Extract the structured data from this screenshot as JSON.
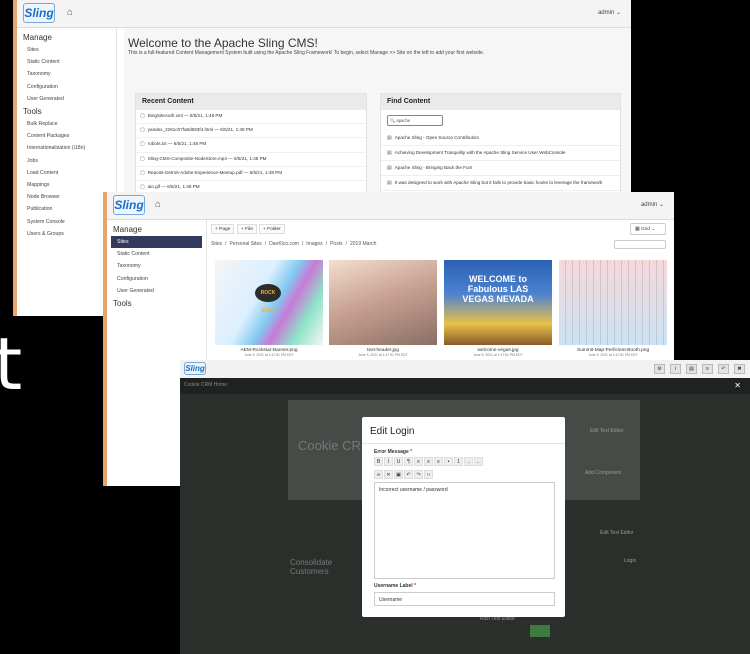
{
  "overlay_char": "t",
  "window1": {
    "user": "admin",
    "sidebar": {
      "manage_title": "Manage",
      "manage_items": [
        "Sites",
        "Static Content",
        "Taxonomy",
        "Configuration",
        "User Generated"
      ],
      "tools_title": "Tools",
      "tools_items": [
        "Bulk Replace",
        "Content Packages",
        "Internationalization (i18n)",
        "Jobs",
        "Load Content",
        "Mappings",
        "Node Browser",
        "Publication",
        "System Console",
        "Users & Groups"
      ]
    },
    "welcome_title": "Welcome to the Apache Sling CMS!",
    "welcome_text": "This is a full-featured Content Management System built using the Apache Sling Framework! To begin, select Manage >> Site on the left to add your first website.",
    "recent": {
      "title": "Recent Content",
      "items": [
        {
          "name": "BingSiteAuth.xml",
          "date": " — 6/5/21, 1:48 PM"
        },
        {
          "name": "yandex_2261c07fa8d583f4.html",
          "date": " — 6/5/21, 1:48 PM"
        },
        {
          "name": "robots.txt",
          "date": " — 6/5/21, 1:48 PM"
        },
        {
          "name": "Sling-CMS-Composite-NodeStore.mp4",
          "date": " — 6/5/21, 1:48 PM"
        },
        {
          "name": "Repoint-Detroit-Adobe-Experience-Meetup.pdf",
          "date": " — 6/5/21, 1:48 PM"
        },
        {
          "name": "aio.gif",
          "date": " — 6/5/21, 1:48 PM"
        }
      ]
    },
    "find": {
      "title": "Find Content",
      "search_value": "apache",
      "results": [
        "Apache Sling - Open Source Contribution",
        "Achieving Development Tranquility with the Apache Sling Service User WebConsole",
        "Apache Sling - Bringing Back the Fun!",
        "It was designed to work with Apache Sling but it fails to provide basic hooks to leverage the framework"
      ]
    }
  },
  "window2": {
    "user": "admin",
    "sidebar": {
      "manage_title": "Manage",
      "items": [
        "Sites",
        "Static Content",
        "Taxonomy",
        "Configuration",
        "User Generated"
      ],
      "tools_title": "Tools"
    },
    "toolbar": {
      "page": "+ Page",
      "file": "+ File",
      "folder": "+ Folder",
      "view": "Grid"
    },
    "breadcrumb": [
      "Sites",
      "/",
      "Personal Sites",
      "/",
      "DanKlco.com",
      "/",
      "Images",
      "/",
      "Posts",
      "/",
      "2019 March"
    ],
    "cards": [
      {
        "name": "AEM-Rockstar-Banner.png",
        "date": "June 5, 2021 at 1:47:51 PM EDT",
        "badge": "ROCK STAR"
      },
      {
        "name": "text-header.jpg",
        "date": "June 5, 2021 at 1:47:51 PM EDT"
      },
      {
        "name": "welcome-vegas.jpg",
        "date": "June 5, 2021 at 1:47:51 PM EDT",
        "sign": "WELCOME to Fabulous LAS VEGAS NEVADA"
      },
      {
        "name": "Summit-Map-Perficient-Booth.png",
        "date": "June 5, 2021 at 1:47:51 PM EDT"
      }
    ]
  },
  "window3": {
    "bar_text": "Cookie CRM   Home",
    "dim_texts": {
      "heading": "Cookie CRM",
      "sub": "Consolidate Customers",
      "edit1": "Edit Text Editor",
      "add1": "Add Component",
      "rt": "Rich Text Editor",
      "edit2": "Edit Text Editor",
      "login": "Login"
    },
    "modal": {
      "title": "Edit Login",
      "error_label": "Error Message",
      "error_value": "Incorrect username / password",
      "username_label": "Username Label",
      "username_value": "Username",
      "required_mark": "*"
    }
  }
}
